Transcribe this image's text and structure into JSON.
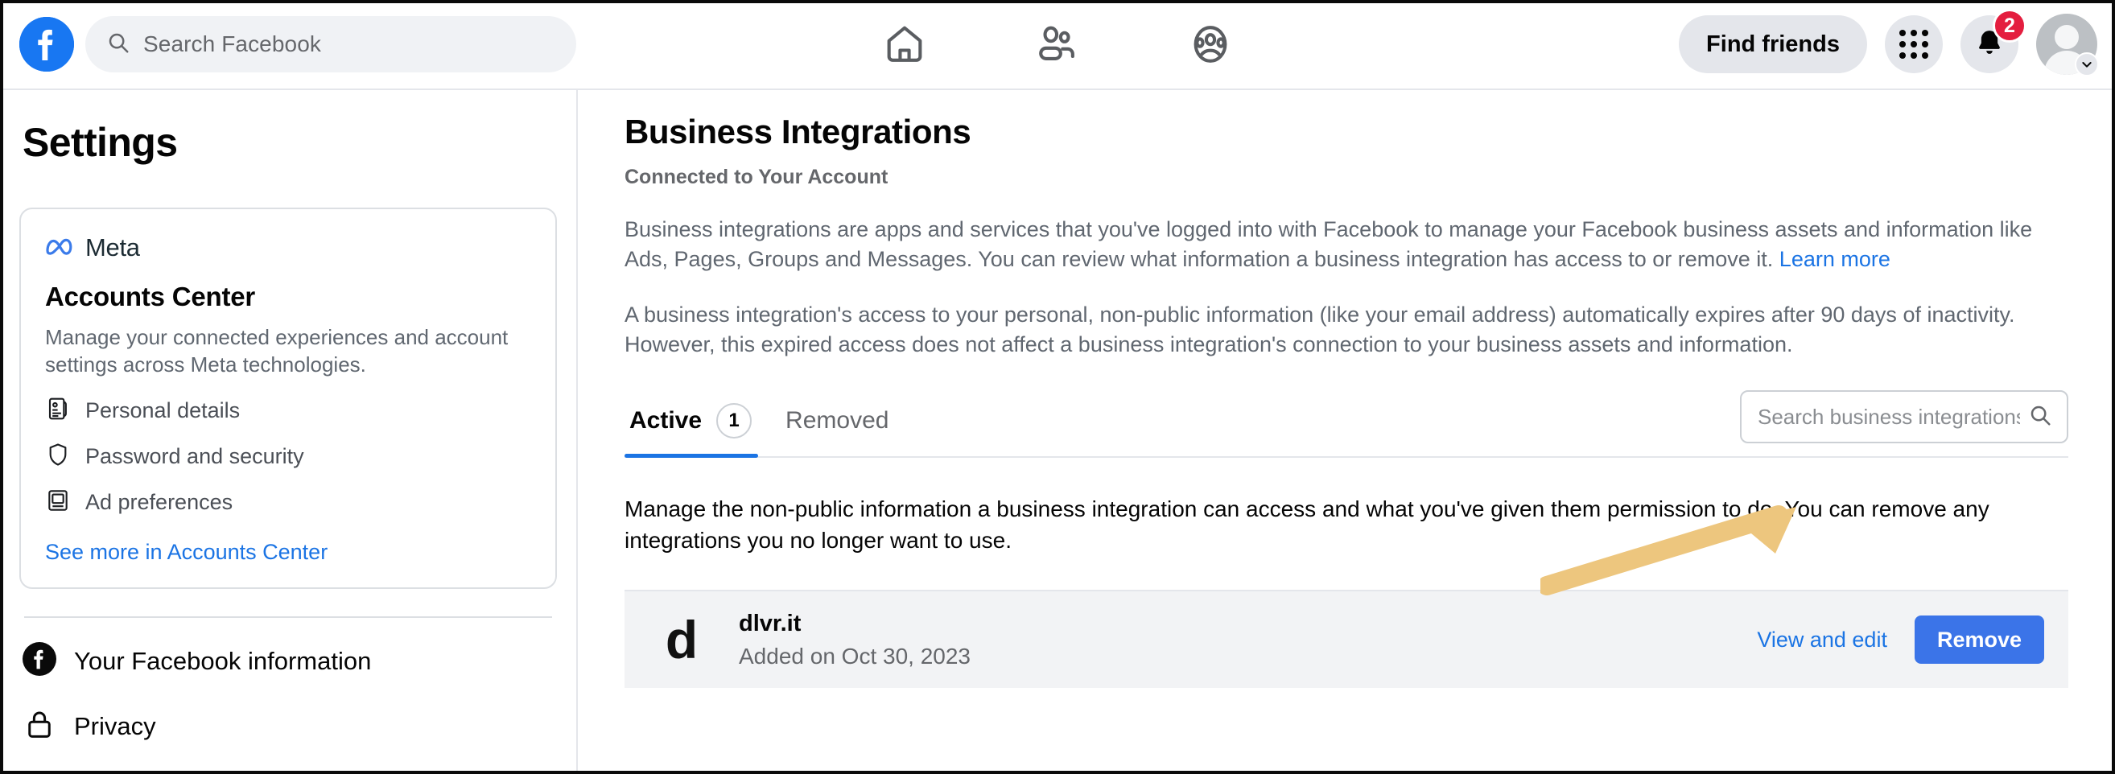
{
  "header": {
    "logo_icon": "facebook-logo-icon",
    "search": {
      "placeholder": "Search Facebook",
      "icon": "search-icon"
    },
    "nav": [
      {
        "name": "home",
        "icon": "home-icon"
      },
      {
        "name": "friends",
        "icon": "friends-icon"
      },
      {
        "name": "groups",
        "icon": "groups-icon"
      }
    ],
    "find_friends_label": "Find friends",
    "menu_icon": "grid-menu-icon",
    "notifications": {
      "icon": "bell-icon",
      "badge_count": "2",
      "badge_color": "#E41E3F"
    },
    "account": {
      "avatar_icon": "avatar",
      "chevron_icon": "chevron-down-icon"
    }
  },
  "sidebar": {
    "title": "Settings",
    "accounts_center": {
      "brand_label": "Meta",
      "brand_icon": "meta-infinity-icon",
      "heading": "Accounts Center",
      "description": "Manage your connected experiences and account settings across Meta technologies.",
      "items": [
        {
          "label": "Personal details",
          "icon": "id-card-icon"
        },
        {
          "label": "Password and security",
          "icon": "shield-icon"
        },
        {
          "label": "Ad preferences",
          "icon": "ad-display-icon"
        }
      ],
      "see_more_label": "See more in Accounts Center"
    },
    "links": [
      {
        "label": "Your Facebook information",
        "icon": "facebook-circle-icon"
      },
      {
        "label": "Privacy",
        "icon": "lock-icon"
      }
    ]
  },
  "main": {
    "title": "Business Integrations",
    "subtitle": "Connected to Your Account",
    "paragraph_1": "Business integrations are apps and services that you've logged into with Facebook to manage your Facebook business assets and information like Ads, Pages, Groups and Messages. You can review what information a business integration has access to or remove it.",
    "paragraph_1_link": "Learn more",
    "paragraph_2": "A business integration's access to your personal, non-public information (like your email address) automatically expires after 90 days of inactivity. However, this expired access does not affect a business integration's connection to your business assets and information.",
    "tabs": [
      {
        "label": "Active",
        "count": "1",
        "selected": true
      },
      {
        "label": "Removed",
        "count": "",
        "selected": false
      }
    ],
    "search": {
      "placeholder": "Search business integrations",
      "icon": "search-icon",
      "value": ""
    },
    "manage_paragraph": "Manage the non-public information a business integration can access and what you've given them permission to do. You can remove any integrations you no longer want to use.",
    "integrations": [
      {
        "logo_letter": "d",
        "name": "dlvr.it",
        "added": "Added on Oct 30, 2023",
        "view_edit_label": "View and edit",
        "remove_label": "Remove"
      }
    ]
  },
  "annotation": {
    "type": "arrow",
    "color": "#EDC67E",
    "points_to": "View and edit"
  },
  "colors": {
    "facebook_blue": "#1877F2",
    "link_blue": "#1b74e4",
    "button_blue": "#3b74e8",
    "badge_red": "#E41E3F",
    "row_gray": "#f2f3f5",
    "pill_gray": "#f0f2f5",
    "text_primary": "#050505",
    "text_secondary": "#65676b"
  }
}
